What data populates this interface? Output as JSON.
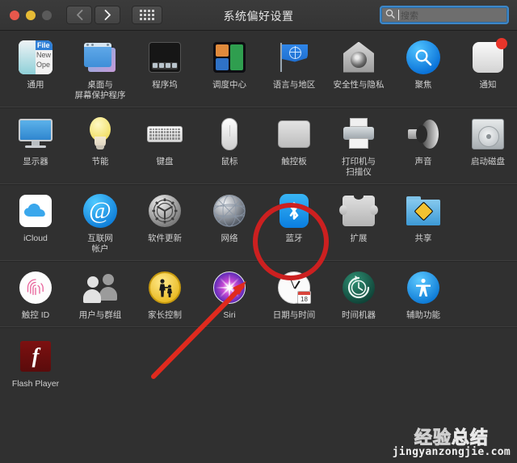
{
  "window": {
    "title": "系统偏好设置",
    "traffic_lights": [
      "close",
      "minimize",
      "zoom"
    ],
    "nav": {
      "back_icon": "chevron-left-icon",
      "forward_icon": "chevron-right-icon",
      "grid_icon": "grid-dots-icon"
    },
    "search": {
      "placeholder": "搜索",
      "value": "",
      "icon": "search-icon",
      "focused": true
    }
  },
  "rows": [
    {
      "items": [
        {
          "label": "通用",
          "icon": "general-icon"
        },
        {
          "label": "桌面与\n屏幕保护程序",
          "icon": "desktop-screensaver-icon"
        },
        {
          "label": "程序坞",
          "icon": "dock-icon"
        },
        {
          "label": "调度中心",
          "icon": "mission-control-icon"
        },
        {
          "label": "语言与地区",
          "icon": "language-region-icon"
        },
        {
          "label": "安全性与隐私",
          "icon": "security-privacy-icon"
        },
        {
          "label": "聚焦",
          "icon": "spotlight-icon"
        },
        {
          "label": "通知",
          "icon": "notifications-icon",
          "badge": true
        }
      ]
    },
    {
      "items": [
        {
          "label": "显示器",
          "icon": "displays-icon"
        },
        {
          "label": "节能",
          "icon": "energy-saver-icon"
        },
        {
          "label": "键盘",
          "icon": "keyboard-icon"
        },
        {
          "label": "鼠标",
          "icon": "mouse-icon"
        },
        {
          "label": "触控板",
          "icon": "trackpad-icon"
        },
        {
          "label": "打印机与\n扫描仪",
          "icon": "printers-scanners-icon"
        },
        {
          "label": "声音",
          "icon": "sound-icon"
        },
        {
          "label": "启动磁盘",
          "icon": "startup-disk-icon"
        }
      ]
    },
    {
      "items": [
        {
          "label": "iCloud",
          "icon": "icloud-icon"
        },
        {
          "label": "互联网\n帐户",
          "icon": "internet-accounts-icon"
        },
        {
          "label": "软件更新",
          "icon": "software-update-icon"
        },
        {
          "label": "网络",
          "icon": "network-icon"
        },
        {
          "label": "蓝牙",
          "icon": "bluetooth-icon",
          "highlighted": true
        },
        {
          "label": "扩展",
          "icon": "extensions-icon"
        },
        {
          "label": "共享",
          "icon": "sharing-icon"
        }
      ]
    },
    {
      "items": [
        {
          "label": "触控 ID",
          "icon": "touch-id-icon"
        },
        {
          "label": "用户与群组",
          "icon": "users-groups-icon"
        },
        {
          "label": "家长控制",
          "icon": "parental-controls-icon"
        },
        {
          "label": "Siri",
          "icon": "siri-icon"
        },
        {
          "label": "日期与时间",
          "icon": "date-time-icon",
          "date_number": "18"
        },
        {
          "label": "时间机器",
          "icon": "time-machine-icon"
        },
        {
          "label": "辅助功能",
          "icon": "accessibility-icon"
        }
      ]
    },
    {
      "items": [
        {
          "label": "Flash Player",
          "icon": "flash-player-icon",
          "glyph": "f"
        }
      ]
    }
  ],
  "annotations": {
    "highlight_circle": {
      "target": "蓝牙",
      "color": "#cc2020",
      "shape": "ellipse"
    },
    "arrow": {
      "color": "#e02a1e",
      "points_to": "蓝牙",
      "shape": "arrow"
    }
  },
  "watermark": {
    "line1_dark": "经验",
    "line1_red": "总结",
    "line2": "jingyanzongjie.com"
  },
  "colors": {
    "window_bg": "#303030",
    "titlebar": "#3a3a3a",
    "label": "#d0d0d0",
    "accent_blue": "#3d87c8",
    "annotation_red": "#cc2020"
  }
}
